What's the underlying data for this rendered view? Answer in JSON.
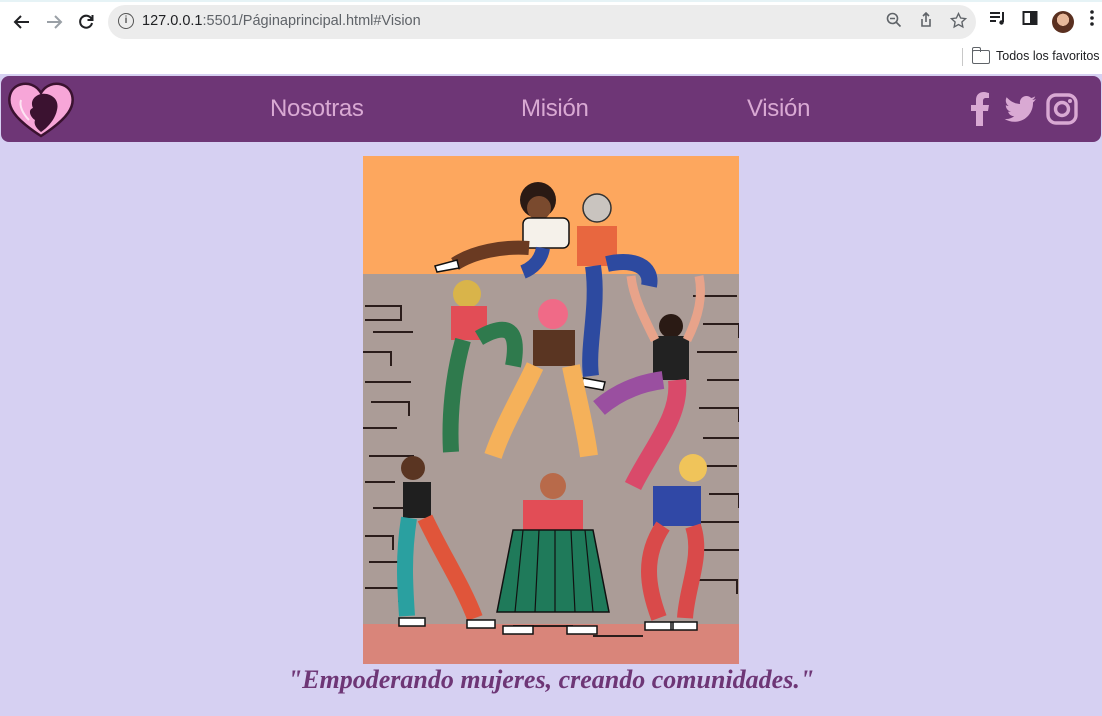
{
  "browser": {
    "url_host": "127.0.0.1",
    "url_rest": ":5501/Páginaprincipal.html#Vision",
    "bookmarks_label": "Todos los favoritos"
  },
  "icons": {
    "back": "back-arrow-icon",
    "forward": "forward-arrow-icon",
    "reload": "reload-icon",
    "site_info": "info-icon",
    "zoom": "zoom-icon",
    "share": "share-icon",
    "bookmark": "star-icon",
    "media": "media-queue-icon",
    "side_panel": "side-panel-icon",
    "menu": "kebab-menu-icon",
    "folder": "folder-icon",
    "logo": "heart-woman-logo-icon",
    "facebook": "facebook-icon",
    "twitter": "twitter-icon",
    "instagram": "instagram-icon"
  },
  "nav": {
    "links": [
      "Nosotras",
      "Misión",
      "Visión"
    ]
  },
  "main": {
    "tagline": "\"Empoderando mujeres, creando comunidades.\""
  },
  "colors": {
    "page_bg": "#d6d0f2",
    "nav_bg": "#6e3676",
    "nav_text": "#d9a9d3",
    "tagline": "#6e3676",
    "illustration_sky": "#fda75e",
    "illustration_wall": "#ab9c97",
    "illustration_floor": "#d9857a"
  }
}
